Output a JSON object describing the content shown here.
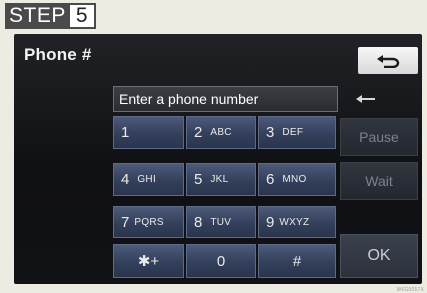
{
  "step": {
    "word": "STEP",
    "number": "5"
  },
  "screen": {
    "title": "Phone #",
    "input_placeholder": "Enter a phone number",
    "keys": [
      {
        "id": "1",
        "num": "1",
        "letters": ""
      },
      {
        "id": "2",
        "num": "2",
        "letters": "ABC"
      },
      {
        "id": "3",
        "num": "3",
        "letters": "DEF"
      },
      {
        "id": "4",
        "num": "4",
        "letters": "GHI"
      },
      {
        "id": "5",
        "num": "5",
        "letters": "JKL"
      },
      {
        "id": "6",
        "num": "6",
        "letters": "MNO"
      },
      {
        "id": "7",
        "num": "7",
        "letters": "PQRS"
      },
      {
        "id": "8",
        "num": "8",
        "letters": "TUV"
      },
      {
        "id": "9",
        "num": "9",
        "letters": "WXYZ"
      },
      {
        "id": "star",
        "num": "✱+",
        "letters": ""
      },
      {
        "id": "0",
        "num": "0",
        "letters": ""
      },
      {
        "id": "hash",
        "num": "#",
        "letters": ""
      }
    ],
    "pause_label": "Pause",
    "wait_label": "Wait",
    "ok_label": "OK",
    "icons": {
      "back": "return-arrow-icon",
      "backspace": "left-arrow-icon"
    }
  },
  "image_code": "W6G0057X"
}
